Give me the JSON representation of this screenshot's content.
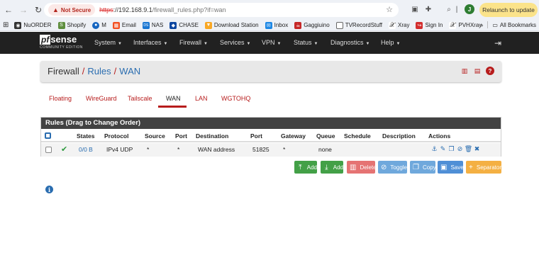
{
  "browser": {
    "not_secure": "Not Secure",
    "url_proto": "https",
    "url_host": "://192.168.9.1",
    "url_path": "/firewall_rules.php?if=wan",
    "avatar": "J",
    "relaunch": "Relaunch to update",
    "bookmarks": [
      "NuORDER",
      "Shopify",
      "M",
      "Email",
      "NAS",
      "CHASE",
      "Download Station",
      "Inbox",
      "Gaggiuino",
      "TVRecordStuff",
      "Xray",
      "Sign In",
      "PVHXray"
    ],
    "more": "»",
    "all_bookmarks": "All Bookmarks"
  },
  "pfsense": {
    "logo_pf": "pf",
    "logo_sense": "sense",
    "logo_edition": "COMMUNITY EDITION",
    "menu": [
      "System",
      "Interfaces",
      "Firewall",
      "Services",
      "VPN",
      "Status",
      "Diagnostics",
      "Help"
    ]
  },
  "breadcrumb": {
    "part1": "Firewall",
    "part2": "Rules",
    "part3": "WAN",
    "sep": "/"
  },
  "tabs": [
    "Floating",
    "WireGuard",
    "Tailscale",
    "WAN",
    "LAN",
    "WGTOHQ"
  ],
  "active_tab": "WAN",
  "rules_panel": {
    "title": "Rules (Drag to Change Order)",
    "headers": [
      "States",
      "Protocol",
      "Source",
      "Port",
      "Destination",
      "Port",
      "Gateway",
      "Queue",
      "Schedule",
      "Description",
      "Actions"
    ],
    "row": {
      "states": "0/0 B",
      "protocol": "IPv4 UDP",
      "source": "*",
      "source_port": "*",
      "destination": "WAN address",
      "dest_port": "51825",
      "gateway": "*",
      "queue": "none",
      "schedule": "",
      "description": ""
    }
  },
  "buttons": {
    "add_top": "Add",
    "add_bottom": "Add",
    "delete": "Delete",
    "toggle": "Toggle",
    "copy": "Copy",
    "save": "Save",
    "separator": "Separator"
  },
  "colors": {
    "accent_red": "#b71c1c",
    "link_blue": "#2a6db0",
    "nav_bg": "#212121",
    "green": "#43a047",
    "orange": "#f4b043"
  }
}
